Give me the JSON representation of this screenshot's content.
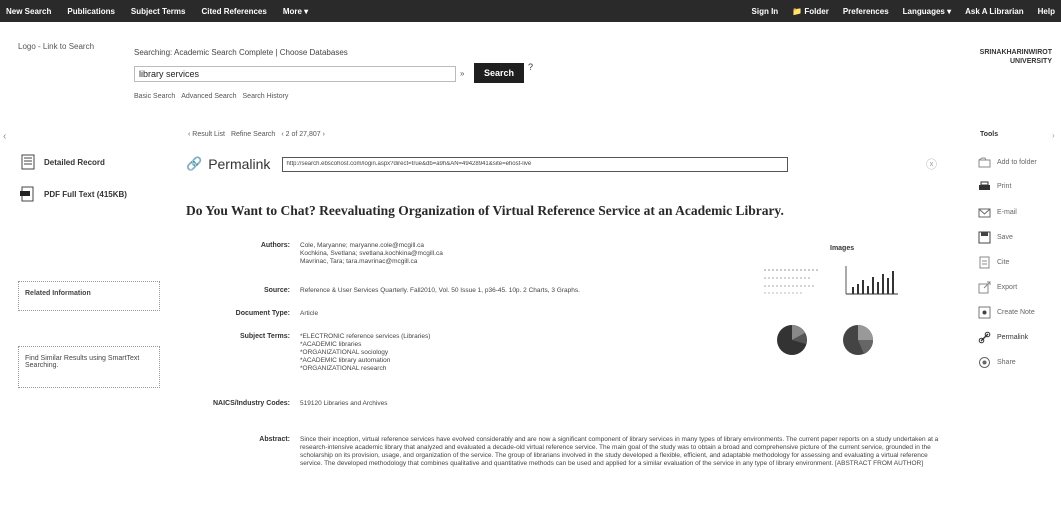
{
  "topnav": {
    "left": [
      "New Search",
      "Publications",
      "Subject Terms",
      "Cited References",
      "More ▾"
    ],
    "right": [
      "Sign In",
      "📁 Folder",
      "Preferences",
      "Languages ▾",
      "Ask A Librarian",
      "Help"
    ]
  },
  "header": {
    "logo": "Logo - Link to Search",
    "searching_prefix": "Searching: Academic Search Complete",
    "choose_db": "Choose Databases",
    "search_value": "library services",
    "field_select": "»",
    "search_button": "Search",
    "help": "?",
    "links": [
      "Basic Search",
      "Advanced Search",
      "Search History"
    ],
    "institution": "SRINAKHARINWIROT UNIVERSITY"
  },
  "result_nav": {
    "back": "‹",
    "result_list": "‹ Result List",
    "refine": "Refine Search",
    "position": "‹ 2 of 27,807 ›"
  },
  "left_panel": {
    "detailed_record": "Detailed Record",
    "pdf": "PDF Full Text (415KB)",
    "related": "Related Information",
    "find_similar": "Find Similar Results using SmartText Searching."
  },
  "permalink": {
    "label": "Permalink",
    "url": "http://search.ebscohost.com/login.aspx?direct=true&db=a9h&AN=49428941&site=ehost-live",
    "close": "ⓧ"
  },
  "article": {
    "title": "Do You Want to Chat? Reevaluating Organization of Virtual Reference Service at an Academic Library.",
    "rows": [
      {
        "label": "Authors:",
        "lines": [
          "Cole, Maryanne; maryanne.cole@mcgill.ca",
          "Kochkina, Svetlana; svetlana.kochkina@mcgill.ca",
          "Mavrinac, Tara; tara.mavrinac@mcgill.ca"
        ]
      },
      {
        "label": "Source:",
        "lines": [
          "Reference & User Services Quarterly. Fall2010, Vol. 50 Issue 1, p36-45. 10p. 2 Charts, 3 Graphs."
        ]
      },
      {
        "label": "Document Type:",
        "lines": [
          "Article"
        ]
      },
      {
        "label": "Subject Terms:",
        "lines": [
          "*ELECTRONIC reference services (Libraries)",
          "*ACADEMIC libraries",
          "*ORGANIZATIONAL sociology",
          "*ACADEMIC library automation",
          "*ORGANIZATIONAL research"
        ]
      },
      {
        "label": "NAICS/Industry Codes:",
        "lines": [
          "519120 Libraries and Archives"
        ]
      }
    ],
    "abstract_label": "Abstract:",
    "abstract": "Since their inception, virtual reference services have evolved considerably and are now a significant component of library services in many types of library environments. The current paper reports on a study undertaken at a research-intensive academic library that analyzed and evaluated a decade-old virtual reference service. The main goal of the study was to obtain a broad and comprehensive picture of the current service, grounded in the scholarship on its provision, usage, and organization of the service. The group of librarians involved in the study developed a flexible, efficient, and adaptable methodology for assessing and evaluating a virtual reference service. The developed methodology that combines qualitative and quantitative methods can be used and applied for a similar evaluation of the service in any type of library environment. [ABSTRACT FROM AUTHOR]"
  },
  "images": {
    "title": "Images"
  },
  "tools": {
    "title": "Tools",
    "chevron": "›",
    "items": [
      {
        "label": "Add to folder",
        "icon": "folder-add-icon"
      },
      {
        "label": "Print",
        "icon": "printer-icon"
      },
      {
        "label": "E-mail",
        "icon": "email-icon"
      },
      {
        "label": "Save",
        "icon": "save-icon"
      },
      {
        "label": "Cite",
        "icon": "cite-icon"
      },
      {
        "label": "Export",
        "icon": "export-icon"
      },
      {
        "label": "Create Note",
        "icon": "note-icon"
      },
      {
        "label": "Permalink",
        "icon": "link-icon"
      },
      {
        "label": "Share",
        "icon": "share-icon"
      }
    ]
  }
}
